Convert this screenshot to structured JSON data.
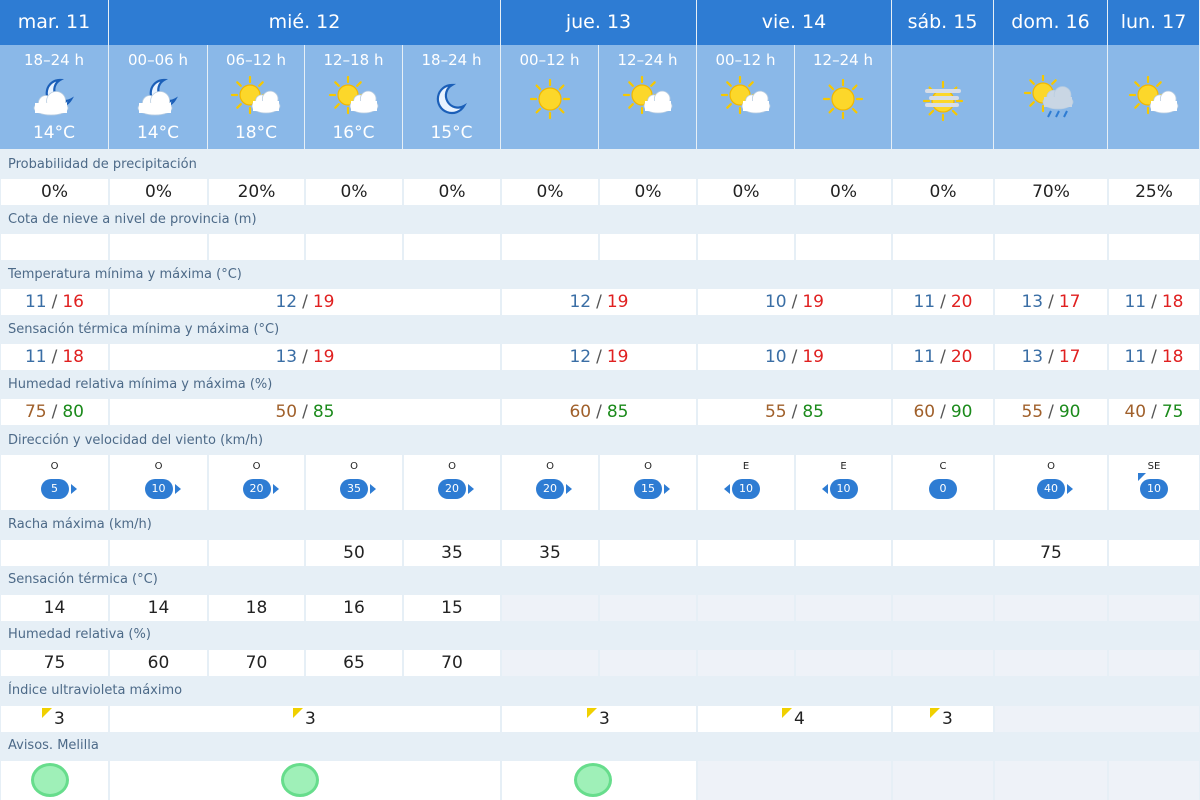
{
  "days": [
    {
      "label": "mar. 11"
    },
    {
      "label": "mié. 12"
    },
    {
      "label": "jue. 13"
    },
    {
      "label": "vie. 14"
    },
    {
      "label": "sáb. 15"
    },
    {
      "label": "dom. 16"
    },
    {
      "label": "lun. 17"
    }
  ],
  "periods": [
    {
      "hours": "18–24 h",
      "icon": "moon-cloud-icon",
      "temp": "14°C"
    },
    {
      "hours": "00–06 h",
      "icon": "moon-cloud-icon",
      "temp": "14°C"
    },
    {
      "hours": "06–12 h",
      "icon": "sun-cloud-icon",
      "temp": "18°C"
    },
    {
      "hours": "12–18 h",
      "icon": "sun-cloud-icon",
      "temp": "16°C"
    },
    {
      "hours": "18–24 h",
      "icon": "moon-icon",
      "temp": "15°C"
    },
    {
      "hours": "00–12 h",
      "icon": "sun-icon",
      "temp": ""
    },
    {
      "hours": "12–24 h",
      "icon": "sun-cloud-icon",
      "temp": ""
    },
    {
      "hours": "00–12 h",
      "icon": "sun-cloud-icon",
      "temp": ""
    },
    {
      "hours": "12–24 h",
      "icon": "sun-icon",
      "temp": ""
    },
    {
      "hours": "",
      "icon": "sun-haze-icon",
      "temp": ""
    },
    {
      "hours": "",
      "icon": "sun-rain-cloud-icon",
      "temp": ""
    },
    {
      "hours": "",
      "icon": "sun-cloud-icon",
      "temp": ""
    }
  ],
  "labels": {
    "precip": "Probabilidad de precipitación",
    "snow": "Cota de nieve a nivel de provincia (m)",
    "temp": "Temperatura mínima y máxima (°C)",
    "feel": "Sensación térmica mínima y máxima (°C)",
    "hum": "Humedad relativa mínima y máxima (%)",
    "wind": "Dirección y velocidad del viento (km/h)",
    "gust": "Racha máxima (km/h)",
    "feel_hourly": "Sensación térmica (°C)",
    "hum_hourly": "Humedad relativa (%)",
    "uv": "Índice ultravioleta máximo",
    "alerts": "Avisos. Melilla"
  },
  "precip": [
    "0%",
    "0%",
    "20%",
    "0%",
    "0%",
    "0%",
    "0%",
    "0%",
    "0%",
    "0%",
    "70%",
    "25%"
  ],
  "temp_minmax": [
    {
      "min": "11",
      "max": "16"
    },
    {
      "min": "12",
      "max": "19"
    },
    {
      "min": "12",
      "max": "19"
    },
    {
      "min": "10",
      "max": "19"
    },
    {
      "min": "11",
      "max": "20"
    },
    {
      "min": "13",
      "max": "17"
    },
    {
      "min": "11",
      "max": "18"
    }
  ],
  "feel_minmax": [
    {
      "min": "11",
      "max": "18"
    },
    {
      "min": "13",
      "max": "19"
    },
    {
      "min": "12",
      "max": "19"
    },
    {
      "min": "10",
      "max": "19"
    },
    {
      "min": "11",
      "max": "20"
    },
    {
      "min": "13",
      "max": "17"
    },
    {
      "min": "11",
      "max": "18"
    }
  ],
  "hum_minmax": [
    {
      "min": "75",
      "max": "80"
    },
    {
      "min": "50",
      "max": "85"
    },
    {
      "min": "60",
      "max": "85"
    },
    {
      "min": "55",
      "max": "85"
    },
    {
      "min": "60",
      "max": "90"
    },
    {
      "min": "55",
      "max": "90"
    },
    {
      "min": "40",
      "max": "75"
    }
  ],
  "wind": [
    {
      "dir": "O",
      "speed": "5",
      "arrow": "right"
    },
    {
      "dir": "O",
      "speed": "10",
      "arrow": "right"
    },
    {
      "dir": "O",
      "speed": "20",
      "arrow": "right"
    },
    {
      "dir": "O",
      "speed": "35",
      "arrow": "right"
    },
    {
      "dir": "O",
      "speed": "20",
      "arrow": "right"
    },
    {
      "dir": "O",
      "speed": "20",
      "arrow": "right"
    },
    {
      "dir": "O",
      "speed": "15",
      "arrow": "right"
    },
    {
      "dir": "E",
      "speed": "10",
      "arrow": "left"
    },
    {
      "dir": "E",
      "speed": "10",
      "arrow": "left"
    },
    {
      "dir": "C",
      "speed": "0",
      "arrow": "none"
    },
    {
      "dir": "O",
      "speed": "40",
      "arrow": "right"
    },
    {
      "dir": "SE",
      "speed": "10",
      "arrow": "se"
    }
  ],
  "gust": [
    "",
    "",
    "",
    "50",
    "35",
    "35",
    "",
    "",
    "",
    "",
    "75",
    ""
  ],
  "feel_hourly": [
    "14",
    "14",
    "18",
    "16",
    "15"
  ],
  "hum_hourly": [
    "75",
    "60",
    "70",
    "65",
    "70"
  ],
  "uv": [
    "3",
    "3",
    "3",
    "4",
    "3",
    ""
  ],
  "slash": "/",
  "colors": {
    "header_dark": "#2e7cd3",
    "header_light": "#8ab8e8",
    "min": "#3a6ea5",
    "max": "#e02020",
    "hum_min": "#a0602b",
    "hum_max": "#1b8a1b",
    "alert_green": "#9ff0b8"
  }
}
